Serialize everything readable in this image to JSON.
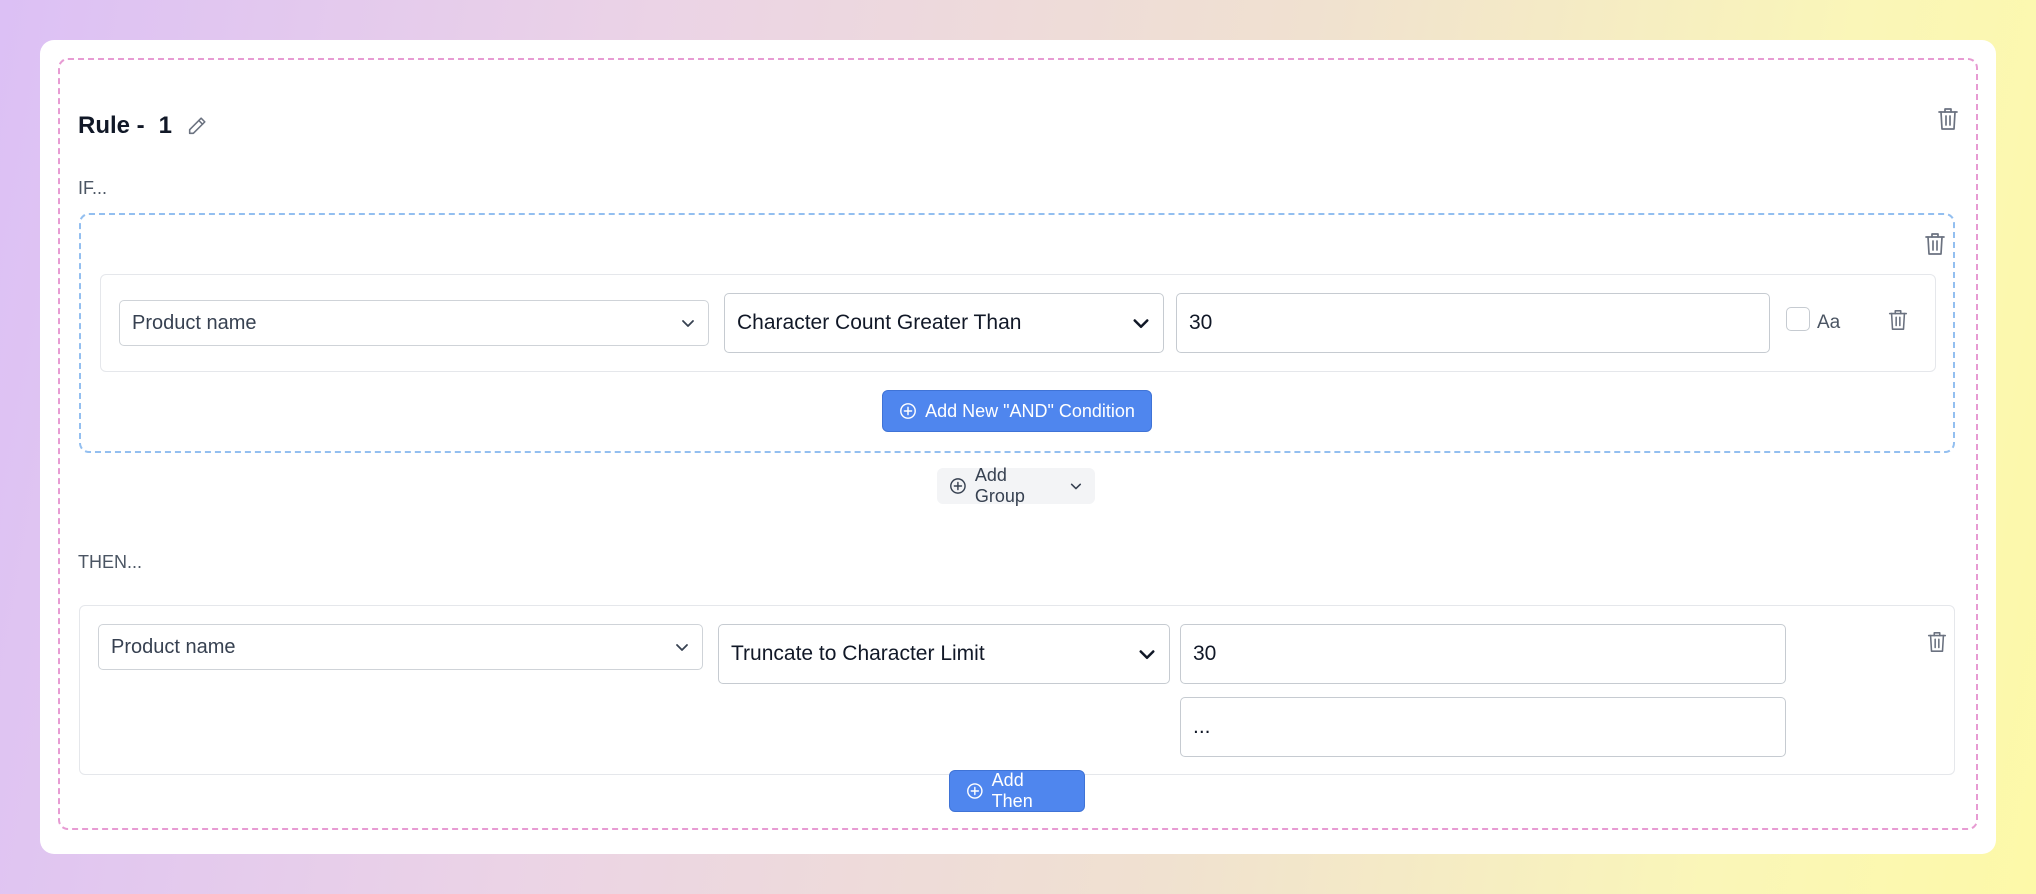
{
  "rule": {
    "title_prefix": "Rule -",
    "number": "1"
  },
  "if_section": {
    "label": "IF...",
    "condition": {
      "field": "Product name",
      "operator": "Character Count Greater Than",
      "value": "30",
      "case_sensitive_label": "Aa",
      "case_sensitive_checked": false
    },
    "add_and_label": "Add New \"AND\" Condition",
    "add_group_label": "Add Group"
  },
  "then_section": {
    "label": "THEN...",
    "action": {
      "field": "Product name",
      "operation": "Truncate to Character Limit",
      "limit_value": "30",
      "suffix_value": "..."
    },
    "add_then_label": "Add Then"
  },
  "colors": {
    "primary": "#4f86ee",
    "rule_border": "#e79bd3",
    "group_border": "#93bff0"
  },
  "icons": {
    "edit": "pencil-icon",
    "delete": "trash-icon",
    "add": "plus-circle-icon",
    "dropdown": "chevron-down-icon"
  }
}
